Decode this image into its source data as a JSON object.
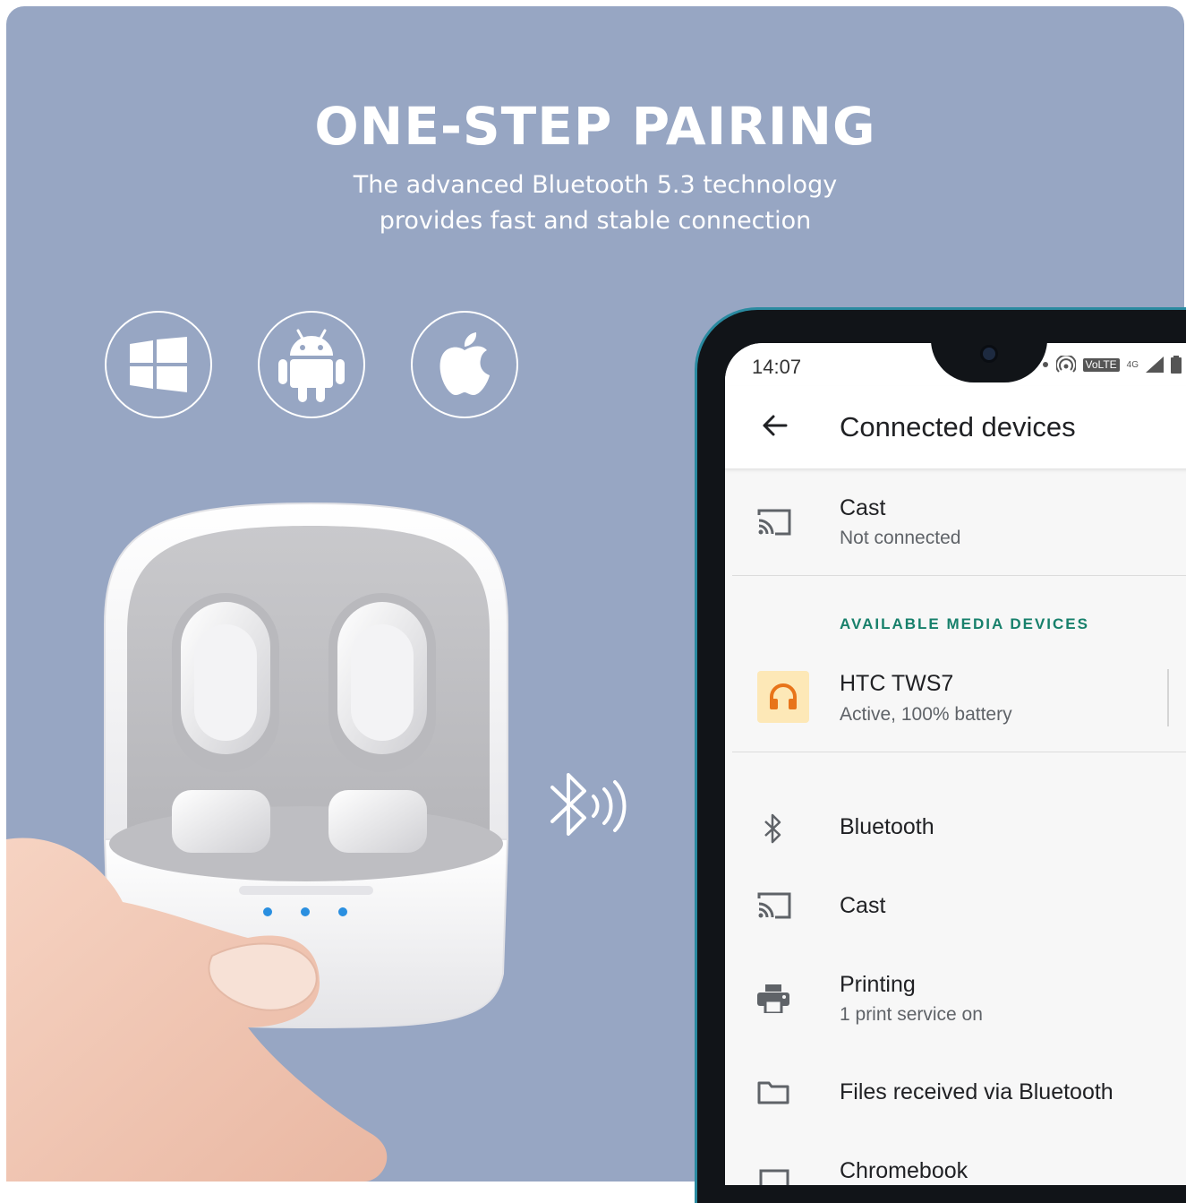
{
  "hero": {
    "title": "ONE-STEP PAIRING",
    "subtitle_line1": "The advanced Bluetooth 5.3 technology",
    "subtitle_line2": "provides fast and stable connection"
  },
  "platform_icons": [
    "windows-icon",
    "android-icon",
    "apple-icon"
  ],
  "colors": {
    "background": "#97a6c3",
    "accent_section": "#17806b",
    "headset_tile": "#fde8b7",
    "headset_icon": "#e8741a",
    "led": "#2a8fe0"
  },
  "phone": {
    "status_bar": {
      "time": "14:07",
      "network": "VoLTE",
      "signal": "4G"
    },
    "app_bar": {
      "title": "Connected devices"
    },
    "cast_top": {
      "title": "Cast",
      "subtitle": "Not connected"
    },
    "available_section": {
      "header": "AVAILABLE MEDIA DEVICES"
    },
    "device": {
      "name": "HTC TWS7",
      "status": "Active, 100% battery"
    },
    "menu": [
      {
        "title": "Bluetooth"
      },
      {
        "title": "Cast"
      },
      {
        "title": "Printing",
        "subtitle": "1 print service on"
      },
      {
        "title": "Files received via Bluetooth"
      },
      {
        "title": "Chromebook"
      }
    ]
  }
}
